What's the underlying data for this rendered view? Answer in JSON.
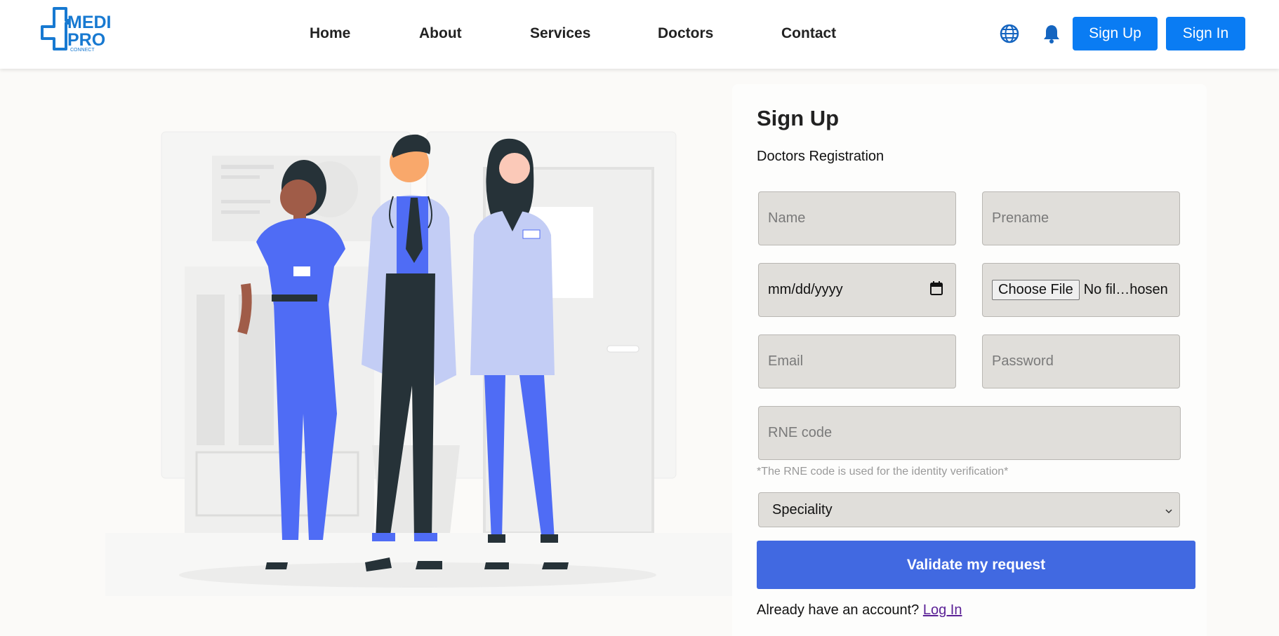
{
  "brand": {
    "logo_line1": "MEDI",
    "logo_line2": "PRO",
    "logo_line3": "CONNECT",
    "color": "#1779d1"
  },
  "nav": {
    "items": [
      "Home",
      "About",
      "Services",
      "Doctors",
      "Contact"
    ]
  },
  "header_actions": {
    "language_icon": "globe-icon",
    "notifications_icon": "bell-icon",
    "signup_label": "Sign Up",
    "signin_label": "Sign In",
    "accent": "#0a7cf3"
  },
  "form": {
    "title": "Sign Up",
    "subtitle": "Doctors Registration",
    "name_placeholder": "Name",
    "prename_placeholder": "Prename",
    "date_placeholder": "mm/dd/yyyy",
    "date_icon": "calendar-icon",
    "file_button": "Choose File",
    "file_status": "No fil…hosen",
    "email_placeholder": "Email",
    "password_placeholder": "Password",
    "rne_placeholder": "RNE code",
    "rne_hint": "*The RNE code is used for the identity verification*",
    "speciality_selected": "Speciality",
    "submit_label": "Validate my request",
    "submit_color": "#4169e1",
    "login_prompt": "Already have an account?",
    "login_link": "Log In"
  }
}
